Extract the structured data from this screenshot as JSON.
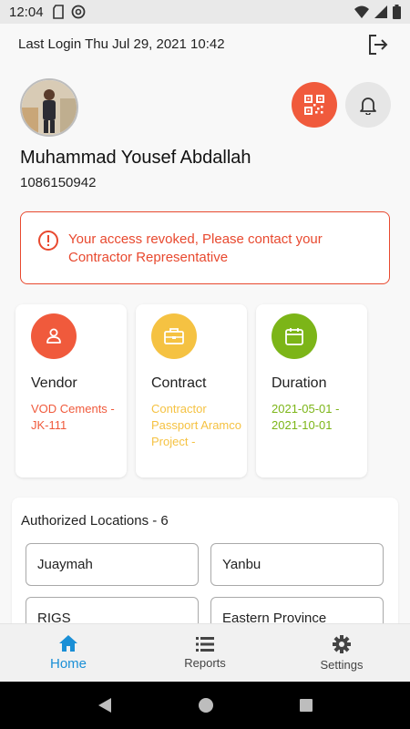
{
  "status_bar": {
    "time": "12:04"
  },
  "header": {
    "last_login": "Last Login Thu Jul 29, 2021 10:42"
  },
  "user": {
    "name": "Muhammad Yousef Abdallah",
    "id": "1086150942"
  },
  "alert": {
    "message": "Your access revoked, Please contact your Contractor Representative"
  },
  "cards": [
    {
      "title": "Vendor",
      "value": "VOD Cements - JK-111",
      "color": "#f05a3c",
      "icon": "person-icon"
    },
    {
      "title": "Contract",
      "value": "Contractor Passport Aramco Project -",
      "color": "#f5c242",
      "icon": "briefcase-icon"
    },
    {
      "title": "Duration",
      "value": "2021-05-01 - 2021-10-01",
      "color": "#7cb518",
      "icon": "calendar-icon"
    }
  ],
  "locations": {
    "title": "Authorized Locations - 6",
    "items": [
      "Juaymah",
      "Yanbu",
      "RIGS",
      "Eastern Province"
    ]
  },
  "bottom_nav": {
    "items": [
      {
        "label": "Home",
        "active": true
      },
      {
        "label": "Reports",
        "active": false
      },
      {
        "label": "Settings",
        "active": false
      }
    ]
  },
  "colors": {
    "accent": "#1a8fd6",
    "alert": "#e8492f",
    "vendor": "#f05a3c",
    "contract": "#f5c242",
    "duration": "#7cb518"
  }
}
